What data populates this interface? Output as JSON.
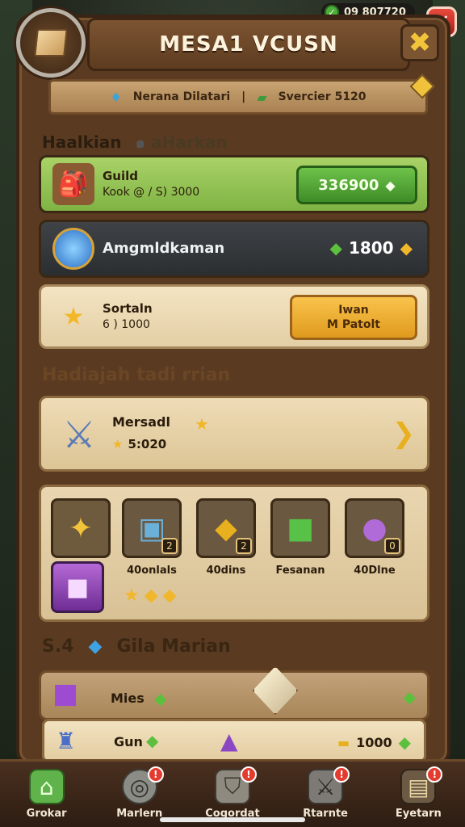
{
  "status": {
    "currency": "09 807720"
  },
  "header": {
    "title": "MESA1 VCUSN"
  },
  "ribbon": {
    "left": "Nerana Dilatari",
    "sep": "|",
    "right": "Svercier 5120"
  },
  "section1": {
    "title": "Haalkian",
    "subtitle": "aHarkan"
  },
  "guild": {
    "name": "Guild",
    "desc": "Kook @ / S) 3000",
    "price": "336900"
  },
  "item2": {
    "name": "Amgmldkaman",
    "price": "1800"
  },
  "item3": {
    "name": "Sortaln",
    "desc": "6 ) 1000",
    "btn_line1": "Iwan",
    "btn_line2": "M Patolt"
  },
  "section2": {
    "title": "Hadiajah tadi  rrian"
  },
  "reward": {
    "name": "Mersadl",
    "value": "5:020"
  },
  "tiles": [
    {
      "label": "",
      "badge": ""
    },
    {
      "label": "40onlals",
      "badge": "2"
    },
    {
      "label": "40dins",
      "badge": "2"
    },
    {
      "label": "Fesanan",
      "badge": ""
    },
    {
      "label": "40Dlne",
      "badge": "0"
    }
  ],
  "section3": {
    "prefix": "S.4",
    "title": "Gila Marian"
  },
  "bottom1": {
    "text": "Mies"
  },
  "bottom2": {
    "text": "Gun",
    "price": "1000"
  },
  "nav": [
    {
      "label": "Grokar",
      "badge": ""
    },
    {
      "label": "Marlern",
      "badge": "!"
    },
    {
      "label": "Cogordat",
      "badge": "!"
    },
    {
      "label": "Rtarnte",
      "badge": "!"
    },
    {
      "label": "Eyetarn",
      "badge": "!"
    }
  ],
  "icons": {
    "status": "green-gem-icon",
    "close": "close-icon",
    "header": "book-emblem-icon",
    "nav": [
      "home-icon",
      "target-icon",
      "shield-icon",
      "swords-icon",
      "chest-icon"
    ]
  },
  "colors": {
    "accent_green": "#6ec24a",
    "accent_gold": "#f9c34c",
    "panel_brown": "#5a3b22",
    "close_red": "#e84a3e"
  }
}
